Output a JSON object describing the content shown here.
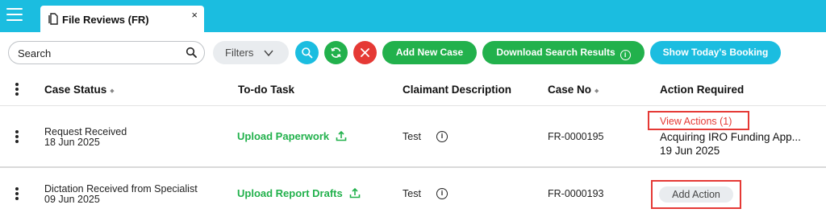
{
  "tab": {
    "title": "File Reviews (FR)",
    "close": "×"
  },
  "toolbar": {
    "search_value": "Search",
    "filters_label": "Filters",
    "add_new_case": "Add New Case",
    "download_search_results": "Download Search Results",
    "download_info": "i",
    "show_todays_booking": "Show Today's Booking"
  },
  "colors": {
    "accent": "#1bbde0",
    "green": "#22b14c",
    "red": "#e53935",
    "danger_btn": "#e53935"
  },
  "table": {
    "headers": {
      "case_status": "Case Status",
      "todo_task": "To-do Task",
      "claimant_description": "Claimant Description",
      "case_no": "Case No",
      "action_required": "Action Required"
    },
    "rows": [
      {
        "status": "Request Received",
        "status_date": "18 Jun 2025",
        "task": "Upload Paperwork",
        "claimant": "Test",
        "case_no": "FR-0000195",
        "action_link": "View Actions (1)",
        "action_text": "Acquiring IRO Funding App...",
        "action_date": "19 Jun 2025"
      },
      {
        "status": "Dictation Received from Specialist",
        "status_date": "09 Jun 2025",
        "task": "Upload Report Drafts",
        "claimant": "Test",
        "case_no": "FR-0000193",
        "action_button": "Add Action"
      }
    ]
  },
  "icons": [
    "hamburger-icon",
    "document-icon",
    "close-icon",
    "search-icon",
    "chevron-down-icon",
    "search-button-icon",
    "refresh-icon",
    "clear-icon",
    "info-icon",
    "upload-icon",
    "kebab-menu-icon",
    "sort-icon"
  ]
}
